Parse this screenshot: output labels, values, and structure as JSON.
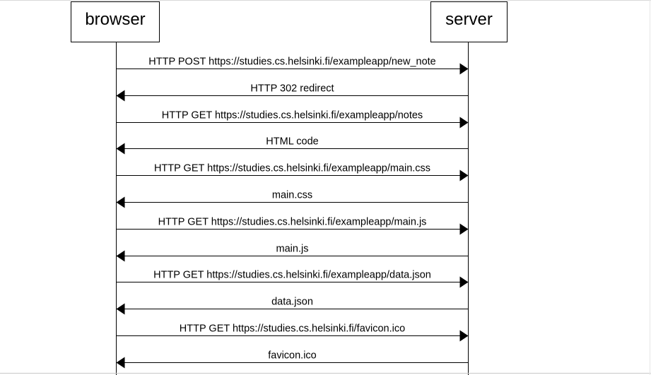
{
  "participants": [
    {
      "name": "browser"
    },
    {
      "name": "server"
    }
  ],
  "messages": [
    {
      "text": "HTTP POST https://studies.cs.helsinki.fi/exampleapp/new_note",
      "from": "browser",
      "to": "server"
    },
    {
      "text": "HTTP 302 redirect",
      "from": "server",
      "to": "browser"
    },
    {
      "text": "HTTP GET https://studies.cs.helsinki.fi/exampleapp/notes",
      "from": "browser",
      "to": "server"
    },
    {
      "text": "HTML code",
      "from": "server",
      "to": "browser"
    },
    {
      "text": "HTTP GET https://studies.cs.helsinki.fi/exampleapp/main.css",
      "from": "browser",
      "to": "server"
    },
    {
      "text": "main.css",
      "from": "server",
      "to": "browser"
    },
    {
      "text": "HTTP GET https://studies.cs.helsinki.fi/exampleapp/main.js",
      "from": "browser",
      "to": "server"
    },
    {
      "text": "main.js",
      "from": "server",
      "to": "browser"
    },
    {
      "text": "HTTP GET https://studies.cs.helsinki.fi/exampleapp/data.json",
      "from": "browser",
      "to": "server"
    },
    {
      "text": "data.json",
      "from": "server",
      "to": "browser"
    },
    {
      "text": "HTTP GET https://studies.cs.helsinki.fi/favicon.ico",
      "from": "browser",
      "to": "server"
    },
    {
      "text": "favicon.ico",
      "from": "server",
      "to": "browser"
    }
  ],
  "colors": {
    "line": "#000000",
    "background": "#ffffff"
  }
}
